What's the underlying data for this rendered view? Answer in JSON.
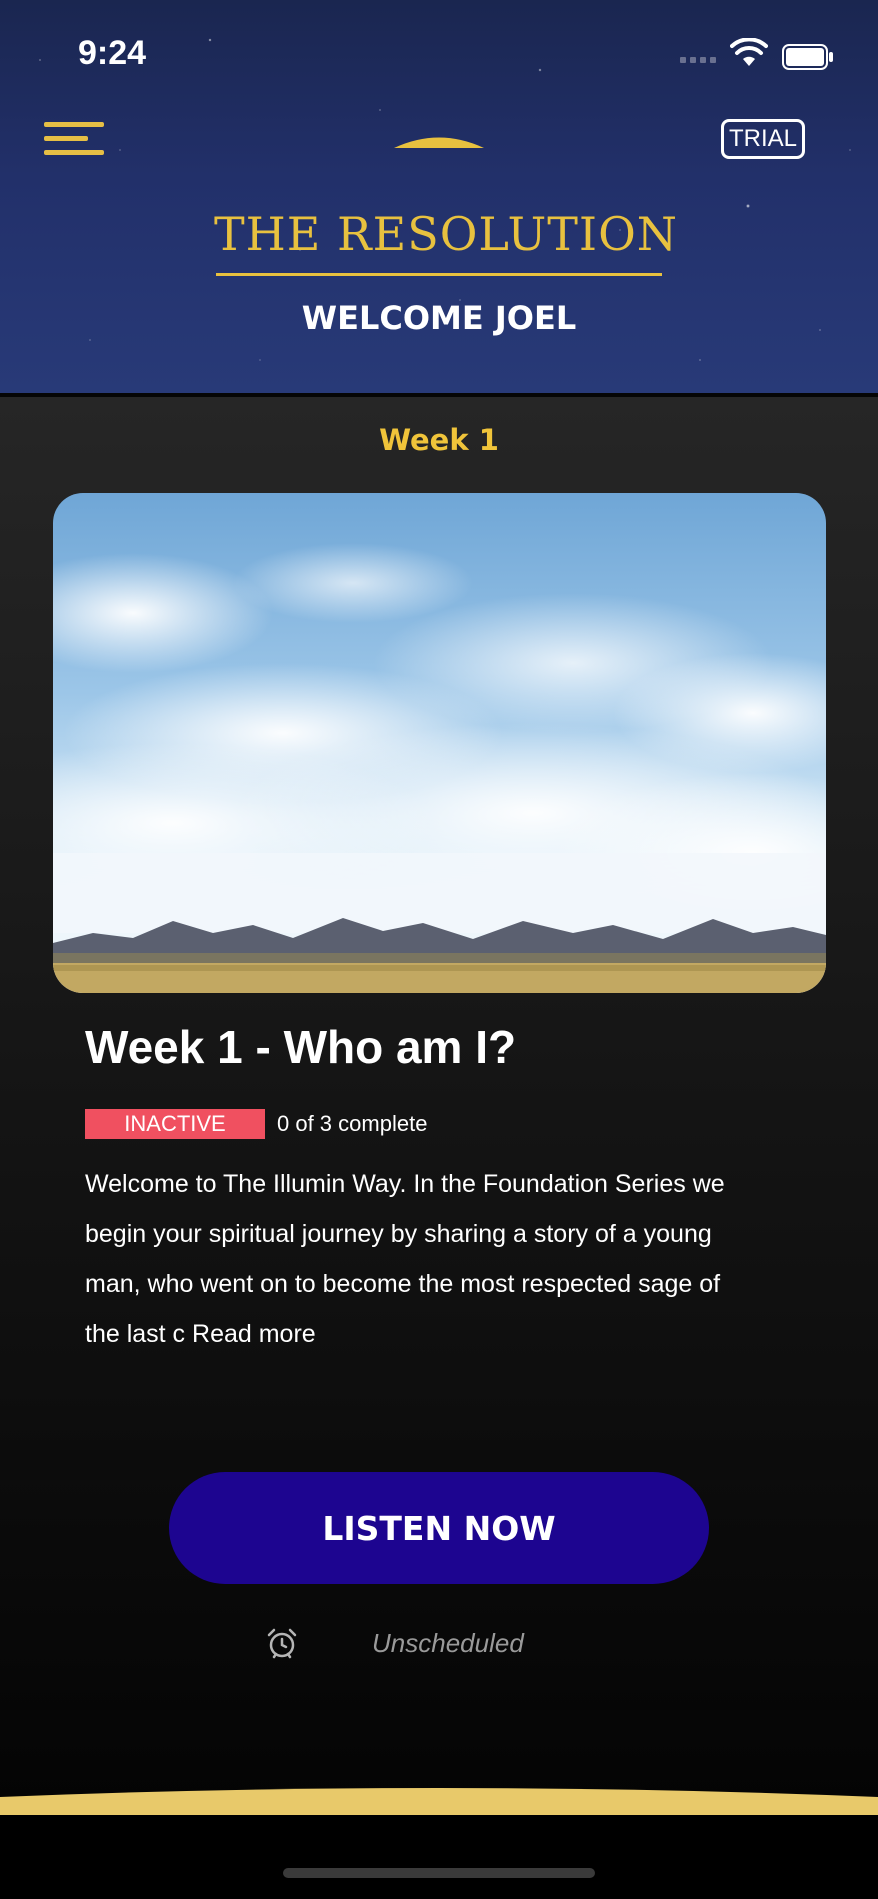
{
  "status_bar": {
    "time": "9:24"
  },
  "header": {
    "trial_label": "TRIAL",
    "app_title": "THE RESOLUTION",
    "welcome": "WELCOME JOEL",
    "menu_icon": "hamburger-menu-icon",
    "logo_icon": "sun-arc-logo-icon"
  },
  "week_label": "Week 1",
  "lesson": {
    "title": "Week 1 - Who am I?",
    "status": "INACTIVE",
    "progress": "0 of 3 complete",
    "description": "Welcome to The Illumin Way. In the Foundation Series we begin your spiritual journey by sharing a story of a young man, who went on to become the most respected sage of the last c",
    "read_more": "Read more"
  },
  "listen_button": "LISTEN NOW",
  "schedule": {
    "icon": "alarm-clock-icon",
    "text": "Unscheduled"
  },
  "colors": {
    "gold": "#e8c13f",
    "button": "#1d0590",
    "inactive_badge": "#f05060",
    "week_label": "#f0c43a"
  }
}
